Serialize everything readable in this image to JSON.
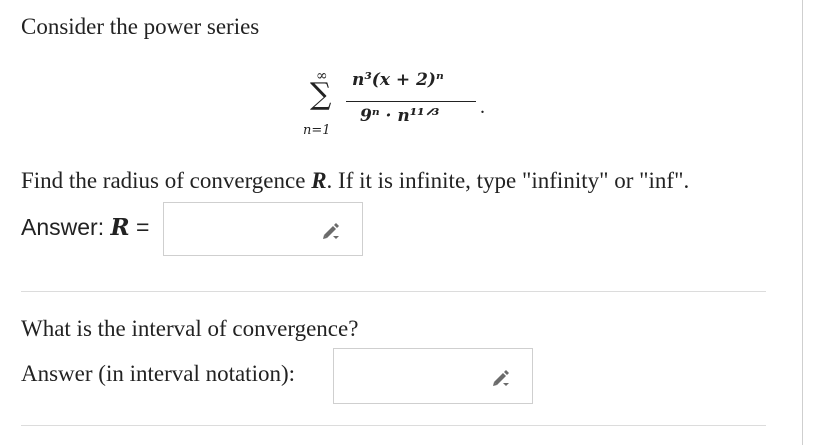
{
  "intro": "Consider the power series",
  "formula": {
    "upper_limit": "∞",
    "sum_symbol": "∑",
    "lower_limit": "n=1",
    "numerator": "n³(x + 2)ⁿ",
    "denominator": "9ⁿ · n¹¹ᐟ³",
    "end": "."
  },
  "question1": {
    "text_before": "Find the radius of convergence ",
    "R": "R",
    "text_after": ". If it is infinite, type \"infinity\" or \"inf\"."
  },
  "answer1": {
    "label_prefix": "Answer: ",
    "R": "R",
    "label_suffix": " =",
    "value": ""
  },
  "question2": {
    "text": "What is the interval of convergence?"
  },
  "answer2": {
    "label": "Answer (in interval notation):",
    "value": ""
  },
  "icons": {
    "input_icon": "pencil-icon"
  },
  "colors": {
    "border": "#cfcfcf",
    "divider": "#dcdcdc",
    "text": "#222222"
  }
}
